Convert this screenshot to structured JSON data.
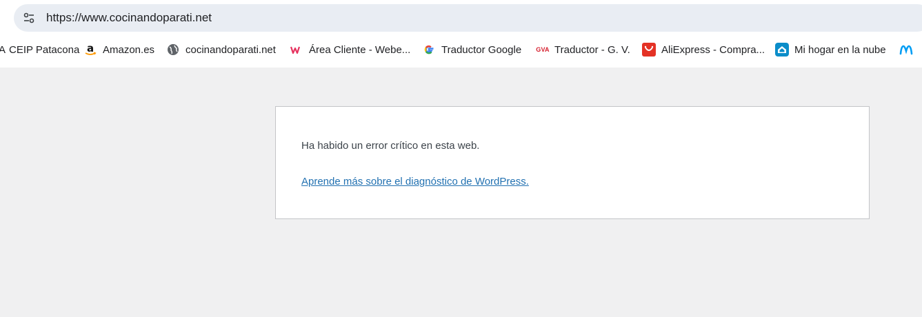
{
  "browser": {
    "url": "https://www.cocinandoparati.net",
    "site_info_icon": "tune-icon",
    "bookmarks": [
      {
        "label": "CEIP Patacona",
        "icon": "bookmark-icon"
      },
      {
        "label": "Amazon.es",
        "icon": "amazon-icon"
      },
      {
        "label": "cocinandoparati.net",
        "icon": "globe-icon"
      },
      {
        "label": "Área Cliente - Webe...",
        "icon": "webempresa-icon"
      },
      {
        "label": "Traductor Google",
        "icon": "google-icon"
      },
      {
        "label": "Traductor - G. V.",
        "icon": "gva-icon"
      },
      {
        "label": "AliExpress - Compra...",
        "icon": "aliexpress-icon"
      },
      {
        "label": "Mi hogar en la nube",
        "icon": "cloud-home-icon"
      },
      {
        "label": "",
        "icon": "movistar-icon"
      }
    ],
    "gva_text": "GVA"
  },
  "error_page": {
    "message": "Ha habido un error crítico en esta web.",
    "link_text": "Aprende más sobre el diagnóstico de WordPress."
  },
  "colors": {
    "page_bg": "#f0f0f1",
    "card_border": "#c3c4c7",
    "link": "#2271b1",
    "text": "#3c434a"
  }
}
